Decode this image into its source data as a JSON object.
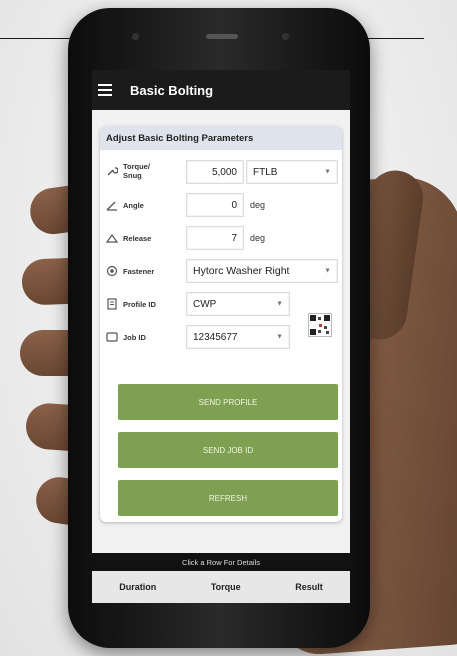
{
  "app": {
    "title": "Basic Bolting",
    "menu_icon": "hamburger-icon"
  },
  "panel": {
    "heading": "Adjust Basic Bolting Parameters"
  },
  "torque": {
    "label": "Torque/ Snug",
    "label_line1": "Torque/",
    "label_line2": "Snug",
    "value": "5,000",
    "unit": "FTLB",
    "icon": "wrench-icon"
  },
  "angle": {
    "label": "Angle",
    "value": "0",
    "unit": "deg",
    "icon": "angle-icon"
  },
  "release": {
    "label": "Release",
    "value": "7",
    "unit": "deg",
    "icon": "release-icon"
  },
  "fastener": {
    "label": "Fastener",
    "value": "Hytorc Washer Right",
    "icon": "fastener-icon"
  },
  "profile": {
    "label": "Profile ID",
    "value": "CWP",
    "icon": "profile-icon"
  },
  "job": {
    "label": "Job ID",
    "value": "12345677",
    "icon": "job-icon"
  },
  "qr": {
    "icon": "qr-code-icon"
  },
  "buttons": {
    "send_profile": "SEND PROFILE",
    "send_job": "SEND JOB ID",
    "refresh": "REFRESH"
  },
  "footer": {
    "details_text": "Click a Row For Details",
    "tabs": [
      "Duration",
      "Torque",
      "Result"
    ]
  },
  "colors": {
    "button": "#7ea151",
    "appbar": "#1b1b1b",
    "header": "#dfe4ec"
  }
}
